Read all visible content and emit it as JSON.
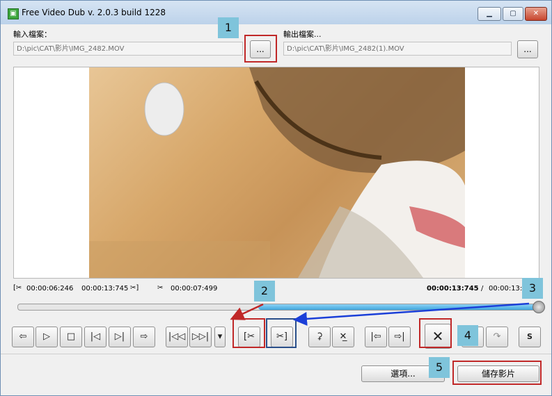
{
  "window": {
    "title": "Free Video Dub  v. 2.0.3 build 1228",
    "app_icon": "film-icon",
    "controls": {
      "minimize": "▁",
      "maximize": "▢",
      "close": "✕"
    }
  },
  "input": {
    "label": "輸入檔案：",
    "path": "D:\\pic\\CAT\\影片\\IMG_2482.MOV",
    "browse": "..."
  },
  "output": {
    "label": "輸出檔案...",
    "path": "D:\\pic\\CAT\\影片\\IMG_2482(1).MOV",
    "browse": "..."
  },
  "timecodes": {
    "start": "00:00:06:246",
    "end": "00:00:13:745",
    "duration": "00:00:07:499",
    "current": "00:00:13:745",
    "separator": "/",
    "total": "00:00:13:"
  },
  "playback_position": 1.0,
  "toolbar_icons": {
    "prev_frame": "⇦",
    "play": "▷",
    "stop": "□",
    "prev_key": "|◁",
    "next_key": "▷|",
    "next_frame": "⇨",
    "go_start": "|◁◁",
    "go_end": "▷▷|",
    "dropdown": "▾",
    "mark_start": "[✂",
    "mark_end": "✂]",
    "keep_selection": "⚳",
    "delete_selection": "✕̲",
    "go_sel_start": "|⇦",
    "go_sel_end": "⇨|",
    "clear": "✕",
    "undo": "↶",
    "redo": "↷",
    "screenshot": "S"
  },
  "footer": {
    "options": "選項...",
    "save": "儲存影片"
  },
  "annotations": [
    "1",
    "2",
    "3",
    "4",
    "5"
  ],
  "colors": {
    "annotation_red": "#c02828",
    "annotation_blue": "#1b3fd8",
    "marker_bg": "#7fc4db"
  }
}
